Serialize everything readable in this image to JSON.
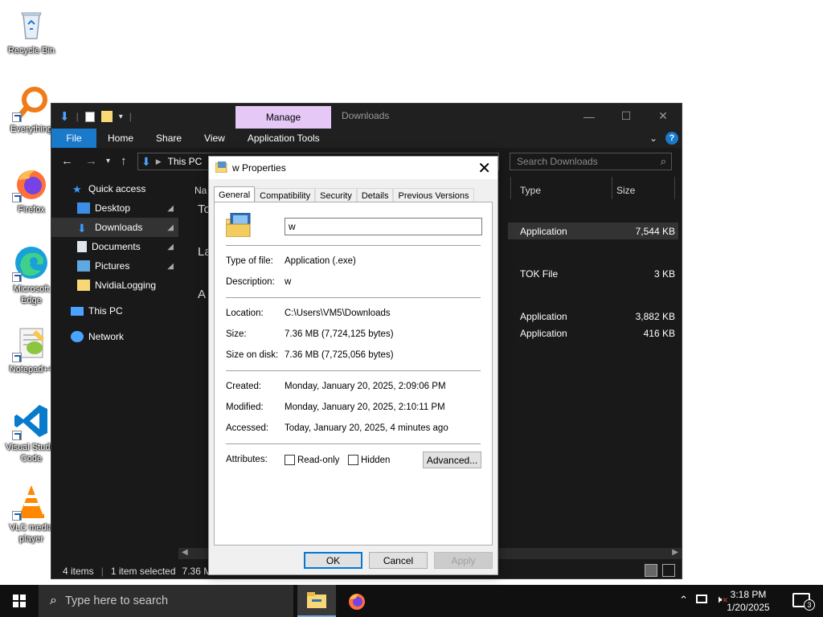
{
  "desktop": {
    "icons": [
      {
        "label": "Recycle Bin",
        "icon": "recycle-bin-icon"
      },
      {
        "label": "Everything",
        "icon": "everything-search-icon"
      },
      {
        "label": "Firefox",
        "icon": "firefox-icon"
      },
      {
        "label": "Microsoft\nEdge",
        "icon": "edge-icon"
      },
      {
        "label": "Notepad++",
        "icon": "notepadpp-icon"
      },
      {
        "label": "Visual Studio\nCode",
        "icon": "vscode-icon"
      },
      {
        "label": "VLC media\nplayer",
        "icon": "vlc-icon"
      }
    ]
  },
  "explorer": {
    "title": "Downloads",
    "manage_tab": "Manage",
    "ribbon_tabs": [
      "File",
      "Home",
      "Share",
      "View",
      "Application Tools"
    ],
    "address": "This PC",
    "search_placeholder": "Search Downloads",
    "nav": {
      "quick_access": "Quick access",
      "items": [
        "Desktop",
        "Downloads",
        "Documents",
        "Pictures",
        "NvidiaLogging"
      ],
      "this_pc": "This PC",
      "network": "Network"
    },
    "columns": {
      "name": "Na",
      "type": "Type",
      "size": "Size"
    },
    "groups": [
      "To",
      "La",
      "A"
    ],
    "files": [
      {
        "type": "Application",
        "size": "7,544 KB"
      },
      {
        "type": "TOK File",
        "size": "3 KB"
      },
      {
        "type": "Application",
        "size": "3,882 KB"
      },
      {
        "type": "Application",
        "size": "416 KB"
      }
    ],
    "status": {
      "items": "4 items",
      "selected": "1 item selected",
      "size": "7.36 M"
    }
  },
  "dialog": {
    "title": "w Properties",
    "tabs": [
      "General",
      "Compatibility",
      "Security",
      "Details",
      "Previous Versions"
    ],
    "name_value": "w",
    "type_label": "Type of file:",
    "type_value": "Application (.exe)",
    "desc_label": "Description:",
    "desc_value": "w",
    "location_label": "Location:",
    "location_value": "C:\\Users\\VM5\\Downloads",
    "size_label": "Size:",
    "size_value": "7.36 MB (7,724,125 bytes)",
    "disk_label": "Size on disk:",
    "disk_value": "7.36 MB (7,725,056 bytes)",
    "created_label": "Created:",
    "created_value": "Monday, January 20, 2025, 2:09:06 PM",
    "modified_label": "Modified:",
    "modified_value": "Monday, January 20, 2025, 2:10:11 PM",
    "accessed_label": "Accessed:",
    "accessed_value": "Today, January 20, 2025, 4 minutes ago",
    "attr_label": "Attributes:",
    "readonly_label": "Read-only",
    "hidden_label": "Hidden",
    "advanced_label": "Advanced...",
    "ok_label": "OK",
    "cancel_label": "Cancel",
    "apply_label": "Apply"
  },
  "taskbar": {
    "search_placeholder": "Type here to search",
    "time": "3:18 PM",
    "date": "1/20/2025",
    "notification_count": "3"
  },
  "colors": {
    "accent": "#1979ca",
    "manage_tab": "#e5c8f6",
    "explorer_bg": "#191919"
  }
}
